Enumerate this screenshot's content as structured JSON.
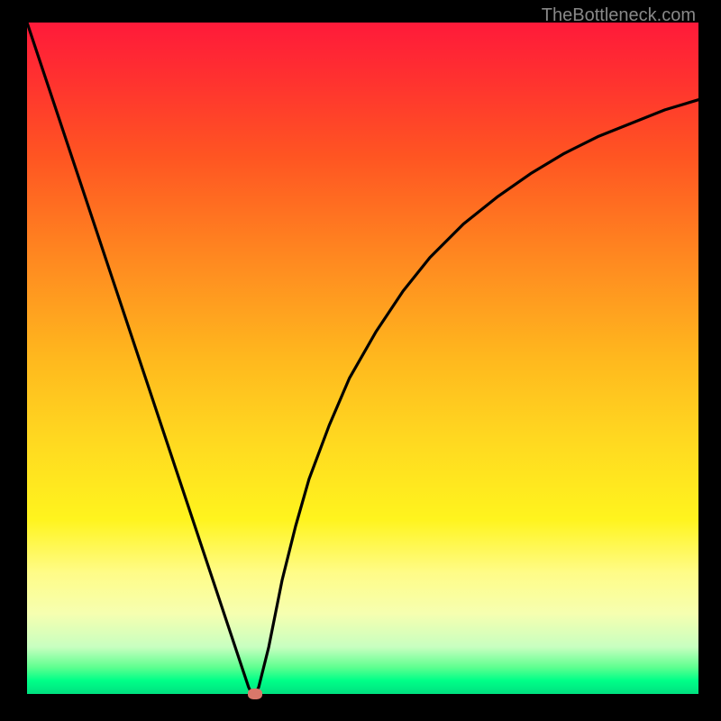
{
  "watermark": "TheBottleneck.com",
  "chart_data": {
    "type": "line",
    "title": "",
    "xlabel": "",
    "ylabel": "",
    "x": [
      0,
      2,
      4,
      6,
      8,
      10,
      12,
      14,
      16,
      18,
      20,
      22,
      24,
      26,
      28,
      30,
      32,
      33,
      33.5,
      34,
      34.5,
      35,
      36,
      37,
      38,
      40,
      42,
      45,
      48,
      52,
      56,
      60,
      65,
      70,
      75,
      80,
      85,
      90,
      95,
      100
    ],
    "y": [
      100,
      94,
      88,
      82,
      76,
      70,
      64,
      58,
      52,
      46,
      40,
      34,
      28,
      22,
      16,
      10,
      4,
      1,
      0,
      0,
      1,
      3,
      7,
      12,
      17,
      25,
      32,
      40,
      47,
      54,
      60,
      65,
      70,
      74,
      77.5,
      80.5,
      83,
      85,
      87,
      88.5
    ],
    "xlim": [
      0,
      100
    ],
    "ylim": [
      0,
      100
    ],
    "marker": {
      "x": 34,
      "y": 0
    },
    "gradient_stops": [
      {
        "pos": 0,
        "color": "#ff1a3a"
      },
      {
        "pos": 50,
        "color": "#ffd820"
      },
      {
        "pos": 100,
        "color": "#00e080"
      }
    ]
  }
}
